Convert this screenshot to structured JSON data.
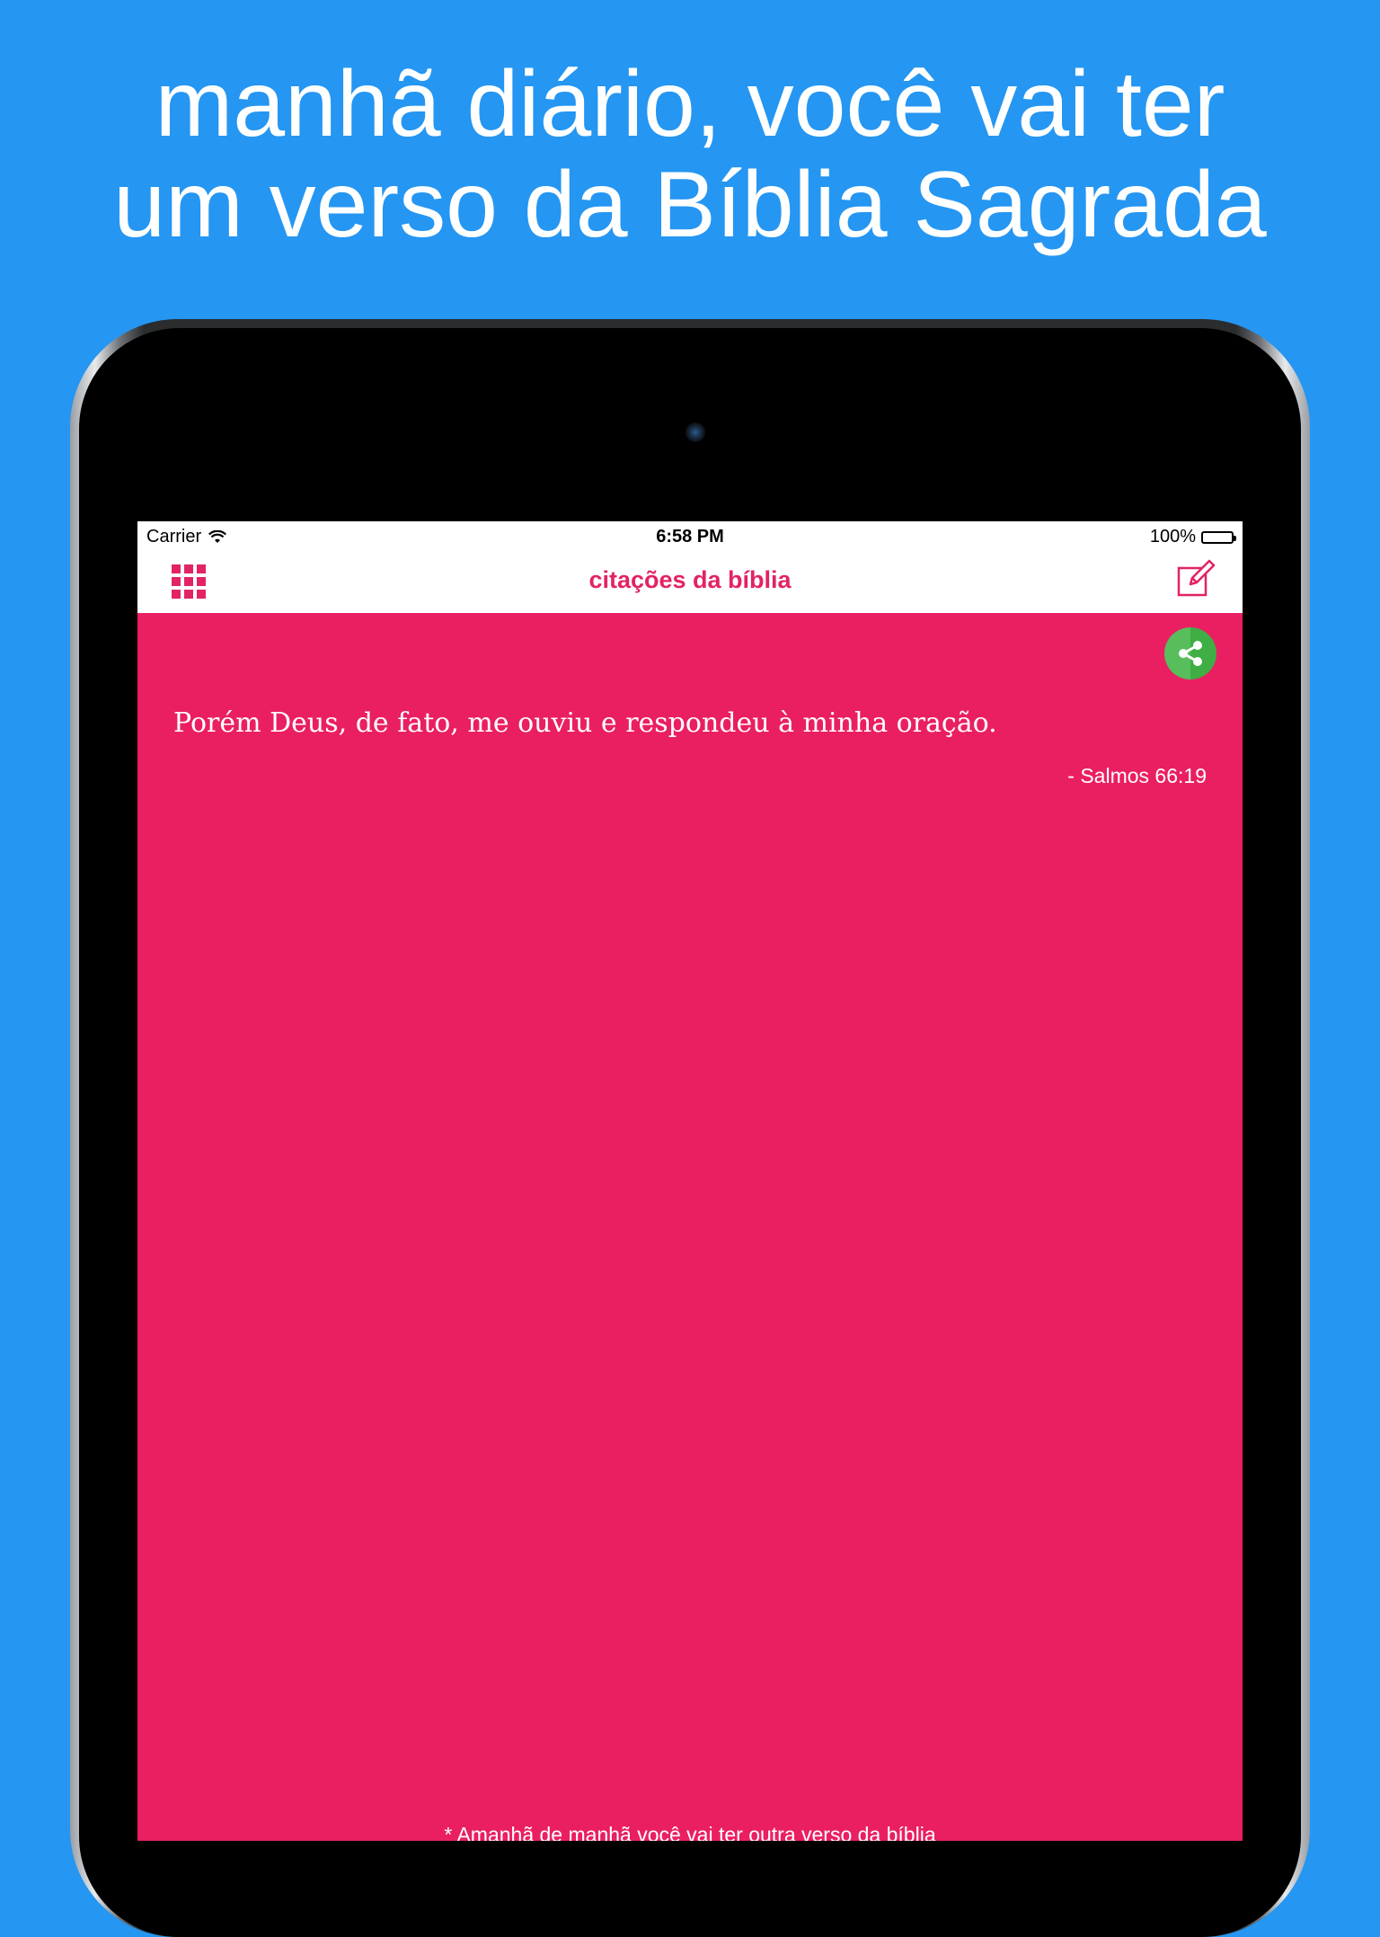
{
  "promo": {
    "line1": "manhã diário, você vai ter",
    "line2": "um verso da Bíblia Sagrada"
  },
  "status_bar": {
    "carrier": "Carrier",
    "time": "6:58 PM",
    "battery": "100%"
  },
  "nav": {
    "title": "citações da bíblia"
  },
  "quote": {
    "text": "Porém Deus, de fato, me ouviu e respondeu à minha oração.",
    "reference": "- Salmos 66:19"
  },
  "footer": {
    "note": "* Amanhã de manhã você vai ter outra verso da bíblia"
  },
  "colors": {
    "background": "#2596F2",
    "accent": "#E22364",
    "screen": "#EA1F62",
    "share": "#4CAF50"
  },
  "icons": {
    "menu": "grid-icon",
    "edit": "compose-icon",
    "share": "share-icon",
    "wifi": "wifi-icon",
    "battery": "battery-icon"
  }
}
